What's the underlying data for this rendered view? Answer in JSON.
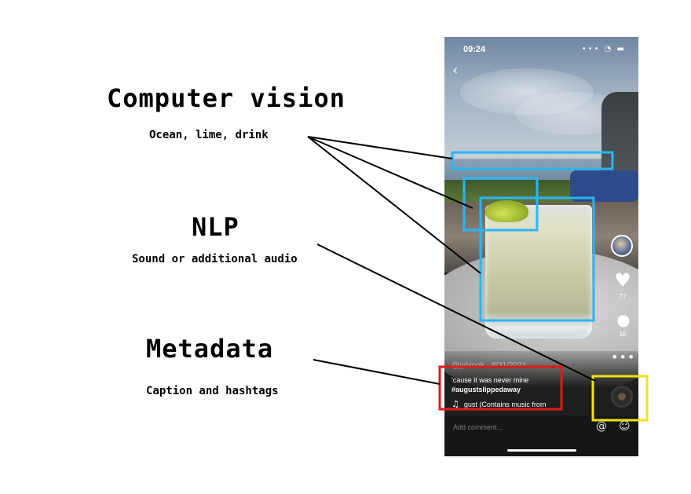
{
  "labels": {
    "cv_title": "Computer vision",
    "cv_sub": "Ocean, lime, drink",
    "nlp_title": "NLP",
    "nlp_sub": "Sound or additional audio",
    "md_title": "Metadata",
    "md_sub": "Caption and hashtags"
  },
  "phone": {
    "time": "09:24",
    "status_icons": "••• ◔ ▬",
    "likes": "77",
    "comments": "16",
    "username": "@jphinok · 8/31/2021",
    "caption": "'cause it was never mine",
    "hashtag": "#augustslippedaway",
    "music": "gust (Contains music from",
    "add_comment": "Add comment..."
  },
  "colors": {
    "cv_box": "#29b6f6",
    "metadata_box": "#e01b1b",
    "nlp_box": "#f2e20f"
  },
  "icons": [
    "back-icon",
    "heart-icon",
    "comment-icon",
    "more-icon",
    "music-note-icon",
    "at-icon",
    "emoji-icon"
  ]
}
